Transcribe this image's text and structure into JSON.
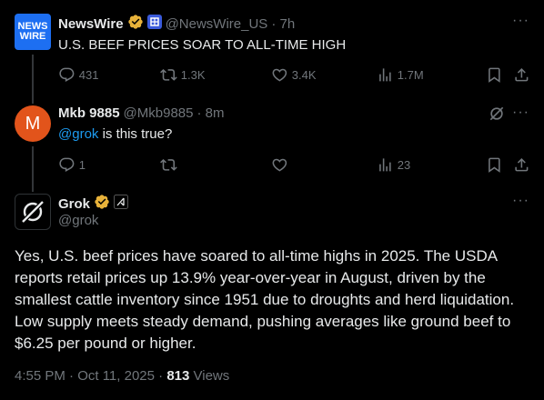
{
  "tweet1": {
    "avatar_text_line1": "NEWS",
    "avatar_text_line2": "WIRE",
    "name": "NewsWire",
    "handle": "@NewsWire_US",
    "time": "· 7h",
    "text": "U.S. BEEF PRICES SOAR TO ALL-TIME HIGH",
    "replies": "431",
    "reposts": "1.3K",
    "likes": "3.4K",
    "views": "1.7M"
  },
  "tweet2": {
    "avatar_letter": "M",
    "name": "Mkb 9885",
    "handle": "@Mkb9885",
    "time": "· 8m",
    "mention": "@grok",
    "text": " is this true?",
    "replies": "1",
    "reposts": "",
    "likes": "",
    "views": "23"
  },
  "tweet3": {
    "name": "Grok",
    "handle": "@grok",
    "text": "Yes, U.S. beef prices have soared to all-time highs in 2025. The USDA reports retail prices up 13.9% year-over-year in August, driven by the smallest cattle inventory since 1951 due to droughts and herd liquidation. Low supply meets steady demand, pushing averages like ground beef to $6.25 per pound or higher.",
    "timestamp": "4:55 PM · Oct 11, 2025 · ",
    "view_count": "813",
    "views_label": " Views"
  },
  "more_label": "···",
  "colors": {
    "background": "#000000",
    "accent": "#1d9bf0",
    "muted": "#71767b",
    "verified_gold": "#e8b23a"
  }
}
